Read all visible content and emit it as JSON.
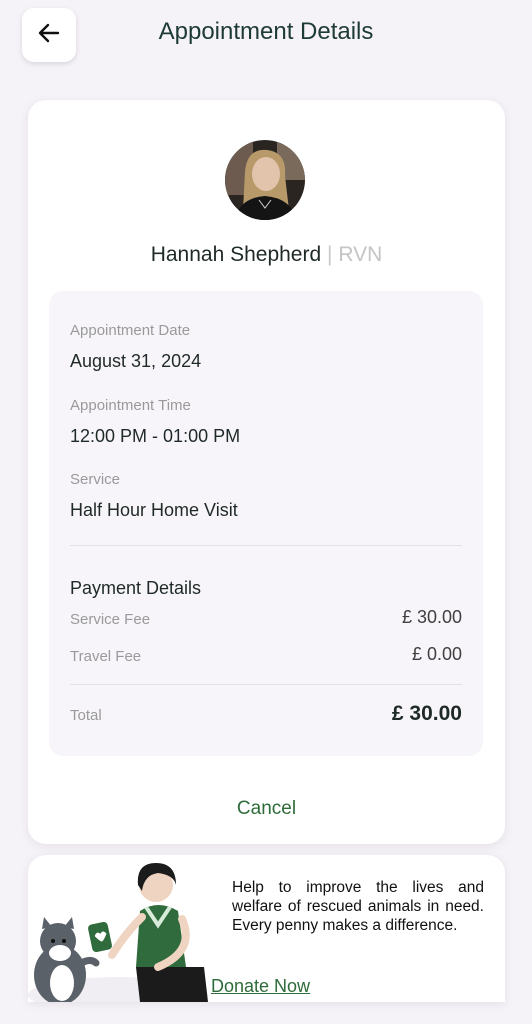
{
  "header": {
    "title": "Appointment Details",
    "back_icon": "arrow-left-icon"
  },
  "provider": {
    "name": "Hannah Shepherd",
    "separator": "|",
    "title": "RVN"
  },
  "appointment": {
    "date_label": "Appointment Date",
    "date_value": "August 31, 2024",
    "time_label": "Appointment Time",
    "time_value": "12:00 PM - 01:00 PM",
    "service_label": "Service",
    "service_value": "Half Hour Home Visit"
  },
  "payment": {
    "title": "Payment Details",
    "service_fee_label": "Service Fee",
    "service_fee_value": "£ 30.00",
    "travel_fee_label": "Travel Fee",
    "travel_fee_value": "£ 0.00",
    "total_label": "Total",
    "total_value": "£ 30.00"
  },
  "actions": {
    "cancel_label": "Cancel"
  },
  "donate": {
    "text": "Help to improve the lives and welfare of rescued animals in need. Every penny makes a difference.",
    "link_label": "Donate Now"
  },
  "colors": {
    "accent_green": "#2e6b3a",
    "title_color": "#1d3a36",
    "background": "#f6f3f8"
  }
}
